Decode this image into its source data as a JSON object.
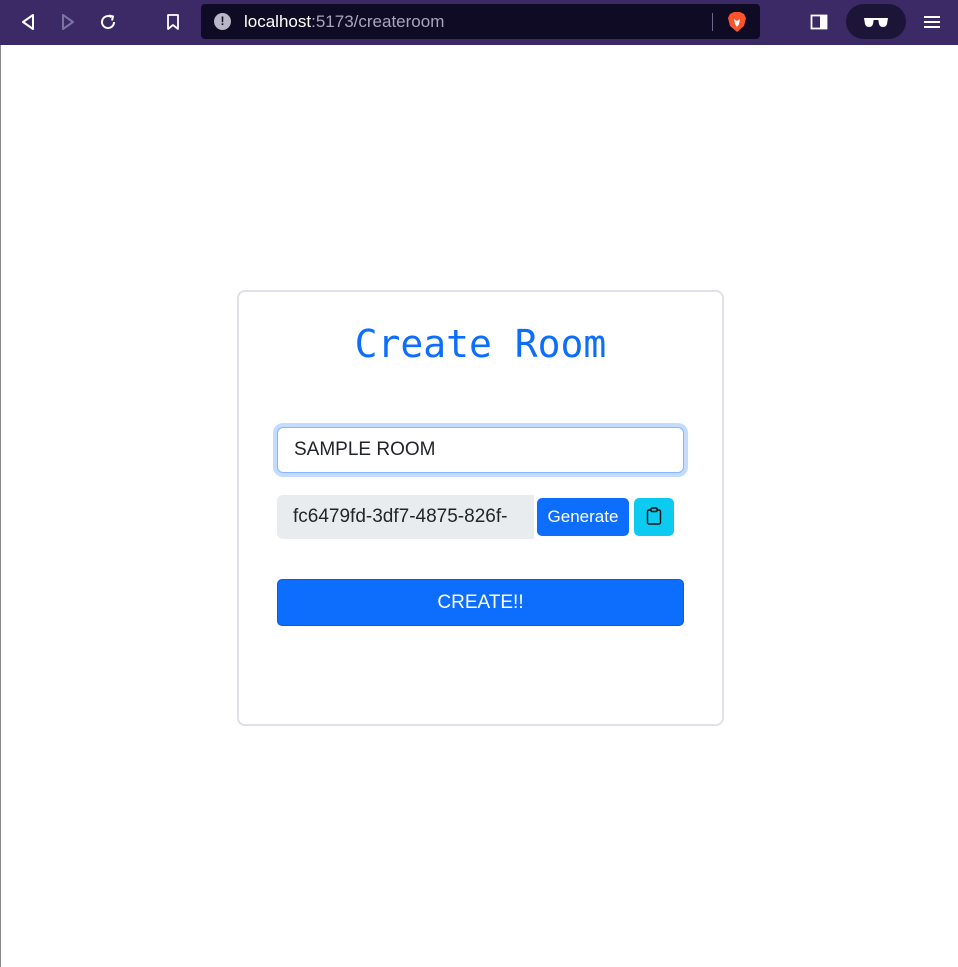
{
  "browser": {
    "url_host": "localhost",
    "url_rest": ":5173/createroom",
    "icons": [
      "back-icon",
      "forward-icon",
      "reload-icon",
      "bookmark-icon",
      "info-icon",
      "brave-shield-icon",
      "sidebar-icon",
      "reader-glasses-icon",
      "menu-icon"
    ],
    "bar_color": "#3b2a66",
    "url_bg_color": "#0f0b24"
  },
  "form": {
    "title": "Create Room",
    "room_name_value": "SAMPLE ROOM",
    "room_id_value": "fc6479fd-3df7-4875-826f-",
    "generate_label": "Generate",
    "create_label": "CREATE!!"
  },
  "colors": {
    "primary": "#0d6efd",
    "info": "#0dcaf0",
    "input_disabled_bg": "#e9ecef",
    "card_border": "#dee2e6"
  }
}
